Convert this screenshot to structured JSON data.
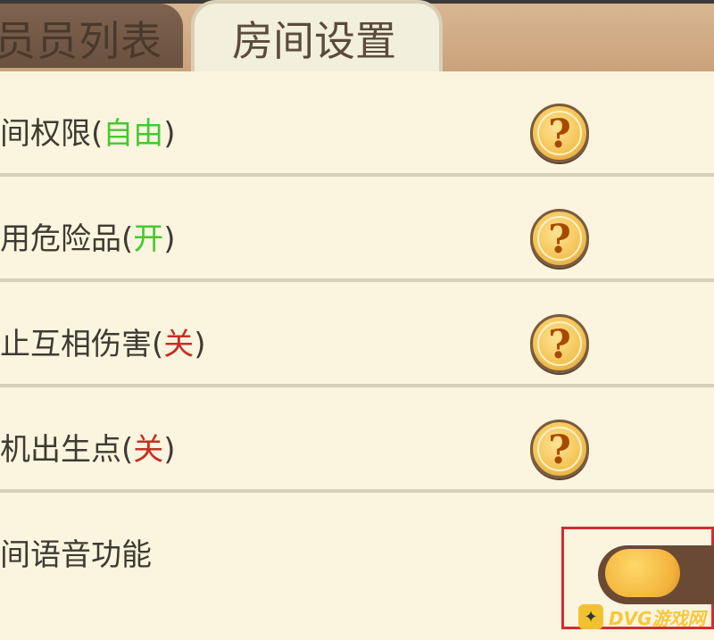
{
  "tabs": {
    "members": "员员列表",
    "room_settings": "房间设置"
  },
  "settings": [
    {
      "prefix": "间权限(",
      "status": "自由",
      "suffix": ")",
      "status_color": "green"
    },
    {
      "prefix": "用危险品(",
      "status": "开",
      "suffix": ")",
      "status_color": "green"
    },
    {
      "prefix": "止互相伤害(",
      "status": "关",
      "suffix": ")",
      "status_color": "red"
    },
    {
      "prefix": "机出生点(",
      "status": "关",
      "suffix": ")",
      "status_color": "red"
    }
  ],
  "voice": {
    "label": "间语音功能",
    "toggle_state": "on"
  },
  "help_icon_glyph": "?",
  "watermark": {
    "text": "DVG游戏网"
  },
  "colors": {
    "status_green": "#43c92f",
    "status_red": "#c62f25",
    "highlight_border": "#d42d2d"
  },
  "icons": [
    "question-mark-icon",
    "toggle-switch"
  ]
}
